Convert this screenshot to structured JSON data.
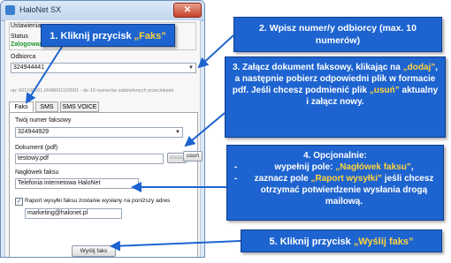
{
  "window": {
    "title": "HaloNet SX",
    "close_glyph": "✕",
    "settings_label": "Ustawienia",
    "status_label": "Status",
    "status_value": "Zalogowany",
    "recipient_label": "Odbiorca",
    "recipient_value": "324944441",
    "recipient_hint": "np: 601100001,0048601102601 - do 10 numerów oddzielonych przecinkami",
    "tabs": [
      "Faks",
      "SMS",
      "SMS VOICE"
    ],
    "fax_number_label": "Twój numer faksowy",
    "fax_number_value": "324944929",
    "document_label": "Dokument (pdf)",
    "document_value": "testowy.pdf",
    "add_button": "dodaj",
    "remove_button": "usuń",
    "header_label": "Nagłówek faksu",
    "header_value": "Telefonia internetowa HaloNet",
    "report_checkbox_label": "Raport wysyłki faksu zostanie wysłany na poniższy adres",
    "report_checked_glyph": "✓",
    "report_email": "marketing@halonet.pl",
    "send_button": "Wyślij faks",
    "dropdown_glyph": "▼"
  },
  "callouts": {
    "c1": {
      "pre": "1. Kliknij przycisk ",
      "hl": "„Faks”"
    },
    "c2": {
      "line1": "2. Wpisz numer/y odbiorcy (max. 10",
      "line2": "numerów)"
    },
    "c3": {
      "p1": "3. Załącz dokument faksowy, klikając na ",
      "hl1": "„dodaj”",
      "p2": ", a następnie pobierz odpowiedni plik w formacie pdf. Jeśli chcesz podmienić plik ",
      "hl2": "„usuń”",
      "p3": " aktualny i załącz nowy."
    },
    "c4": {
      "title": "4. Opcjonalnie:",
      "dash": "-",
      "b1_pre": "wypełnij pole: ",
      "b1_hl": "„Nagłówek faksu”",
      "b1_post": ",",
      "b2_pre": "zaznacz pole ",
      "b2_hl": "„Raport wysyłki”",
      "b2_post": " jeśli chcesz otrzymać potwierdzenie wysłania drogą mailową."
    },
    "c5": {
      "pre": "5. Kliknij przycisk ",
      "hl": "„Wyślij faks”"
    }
  },
  "colors": {
    "callout_bg": "#1e64d0",
    "highlight": "#ffd43c",
    "status_green": "#1f9a2e"
  }
}
